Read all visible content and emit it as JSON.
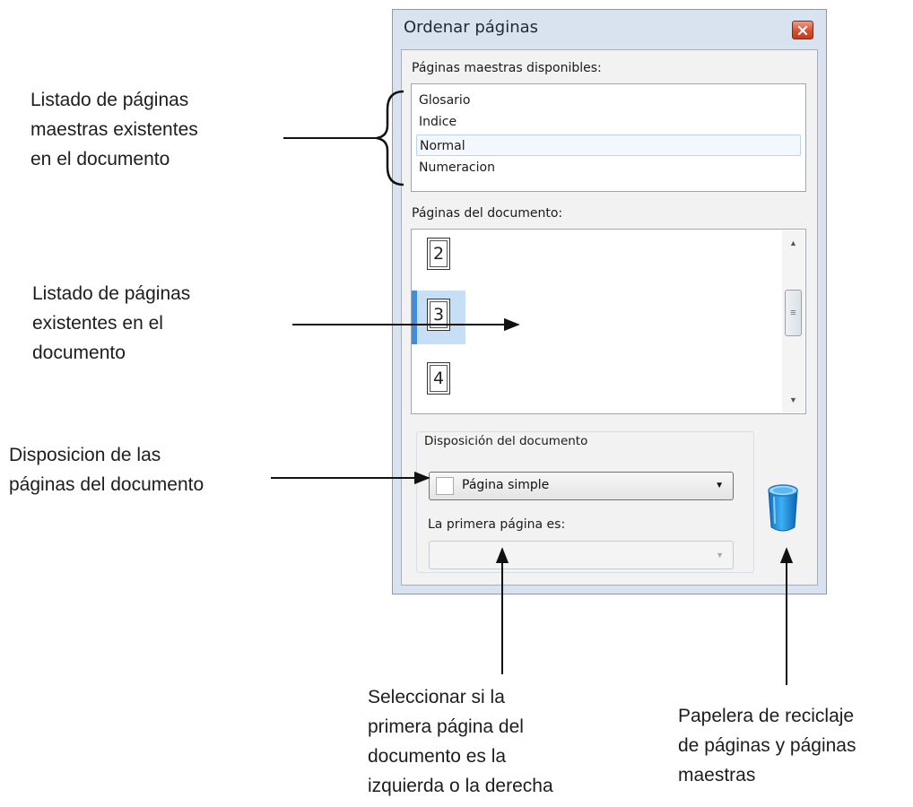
{
  "dialog": {
    "title": "Ordenar páginas",
    "close_icon": "close-icon",
    "master_pages_label": "Páginas maestras disponibles:",
    "master_pages": [
      "Glosario",
      "Indice",
      "Normal",
      "Numeracion"
    ],
    "selected_master": "Normal",
    "document_pages_label": "Páginas del documento:",
    "document_pages": [
      "2",
      "3",
      "4"
    ],
    "selected_page": "3",
    "layout_group_label": "Disposición del documento",
    "layout_value": "Página simple",
    "first_page_label": "La primera página es:",
    "first_page_value": "",
    "trash_icon": "recycle-bin-icon"
  },
  "annotations": {
    "master_list": [
      "Listado de páginas",
      "maestras existentes",
      "en el documento"
    ],
    "pages_list": [
      "Listado de páginas",
      "existentes en el",
      "documento"
    ],
    "layout": [
      "Disposicion de las",
      "páginas del documento"
    ],
    "first_page": [
      "Seleccionar si la",
      "primera página del",
      "documento es la",
      "izquierda o la derecha"
    ],
    "trash": [
      "Papelera de reciclaje",
      "de páginas y páginas",
      "maestras"
    ]
  },
  "colors": {
    "window_frame": "#d9e3ef",
    "selection": "#c6dff5",
    "selection_accent": "#3f8fdc",
    "close_button": "#d8502f",
    "bin": "#1e8fe0"
  }
}
